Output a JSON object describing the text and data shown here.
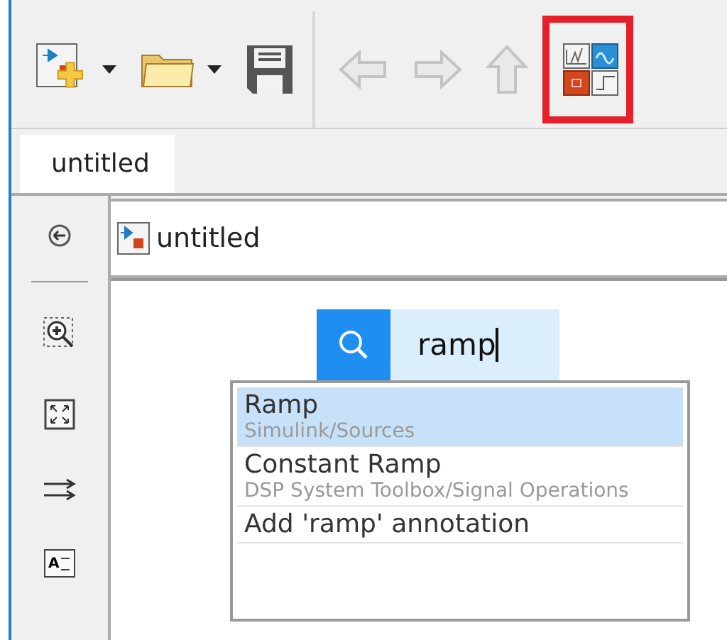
{
  "toolbar": {
    "groups": [
      {
        "buttons": [
          {
            "kind": "new-model",
            "dropdown": true,
            "disabled": false,
            "highlighted": false
          },
          {
            "kind": "open",
            "dropdown": true,
            "disabled": false,
            "highlighted": false
          },
          {
            "kind": "save",
            "dropdown": false,
            "disabled": false,
            "highlighted": false
          }
        ]
      },
      {
        "buttons": [
          {
            "kind": "back",
            "dropdown": false,
            "disabled": true,
            "highlighted": false
          },
          {
            "kind": "forward",
            "dropdown": false,
            "disabled": true,
            "highlighted": false
          },
          {
            "kind": "up",
            "dropdown": false,
            "disabled": true,
            "highlighted": false
          },
          {
            "kind": "library-browser",
            "dropdown": false,
            "disabled": false,
            "highlighted": true
          }
        ]
      }
    ]
  },
  "tabs": [
    {
      "label": "untitled",
      "selected": true
    }
  ],
  "address_bar": {
    "path": "untitled"
  },
  "sidebar": {
    "tools": [
      {
        "kind": "back"
      },
      {
        "kind": "divider"
      },
      {
        "kind": "zoom"
      },
      {
        "kind": "fit"
      },
      {
        "kind": "arrows"
      },
      {
        "kind": "annotation",
        "letter": "A"
      }
    ]
  },
  "quick_insert": {
    "value": "ramp",
    "results": [
      {
        "title": "Ramp",
        "subtitle": "Simulink/Sources",
        "selected": true
      },
      {
        "title": "Constant Ramp",
        "subtitle": "DSP System Toolbox/Signal Operations",
        "selected": false
      },
      {
        "title": "Add 'ramp' annotation",
        "selected": false
      }
    ]
  }
}
